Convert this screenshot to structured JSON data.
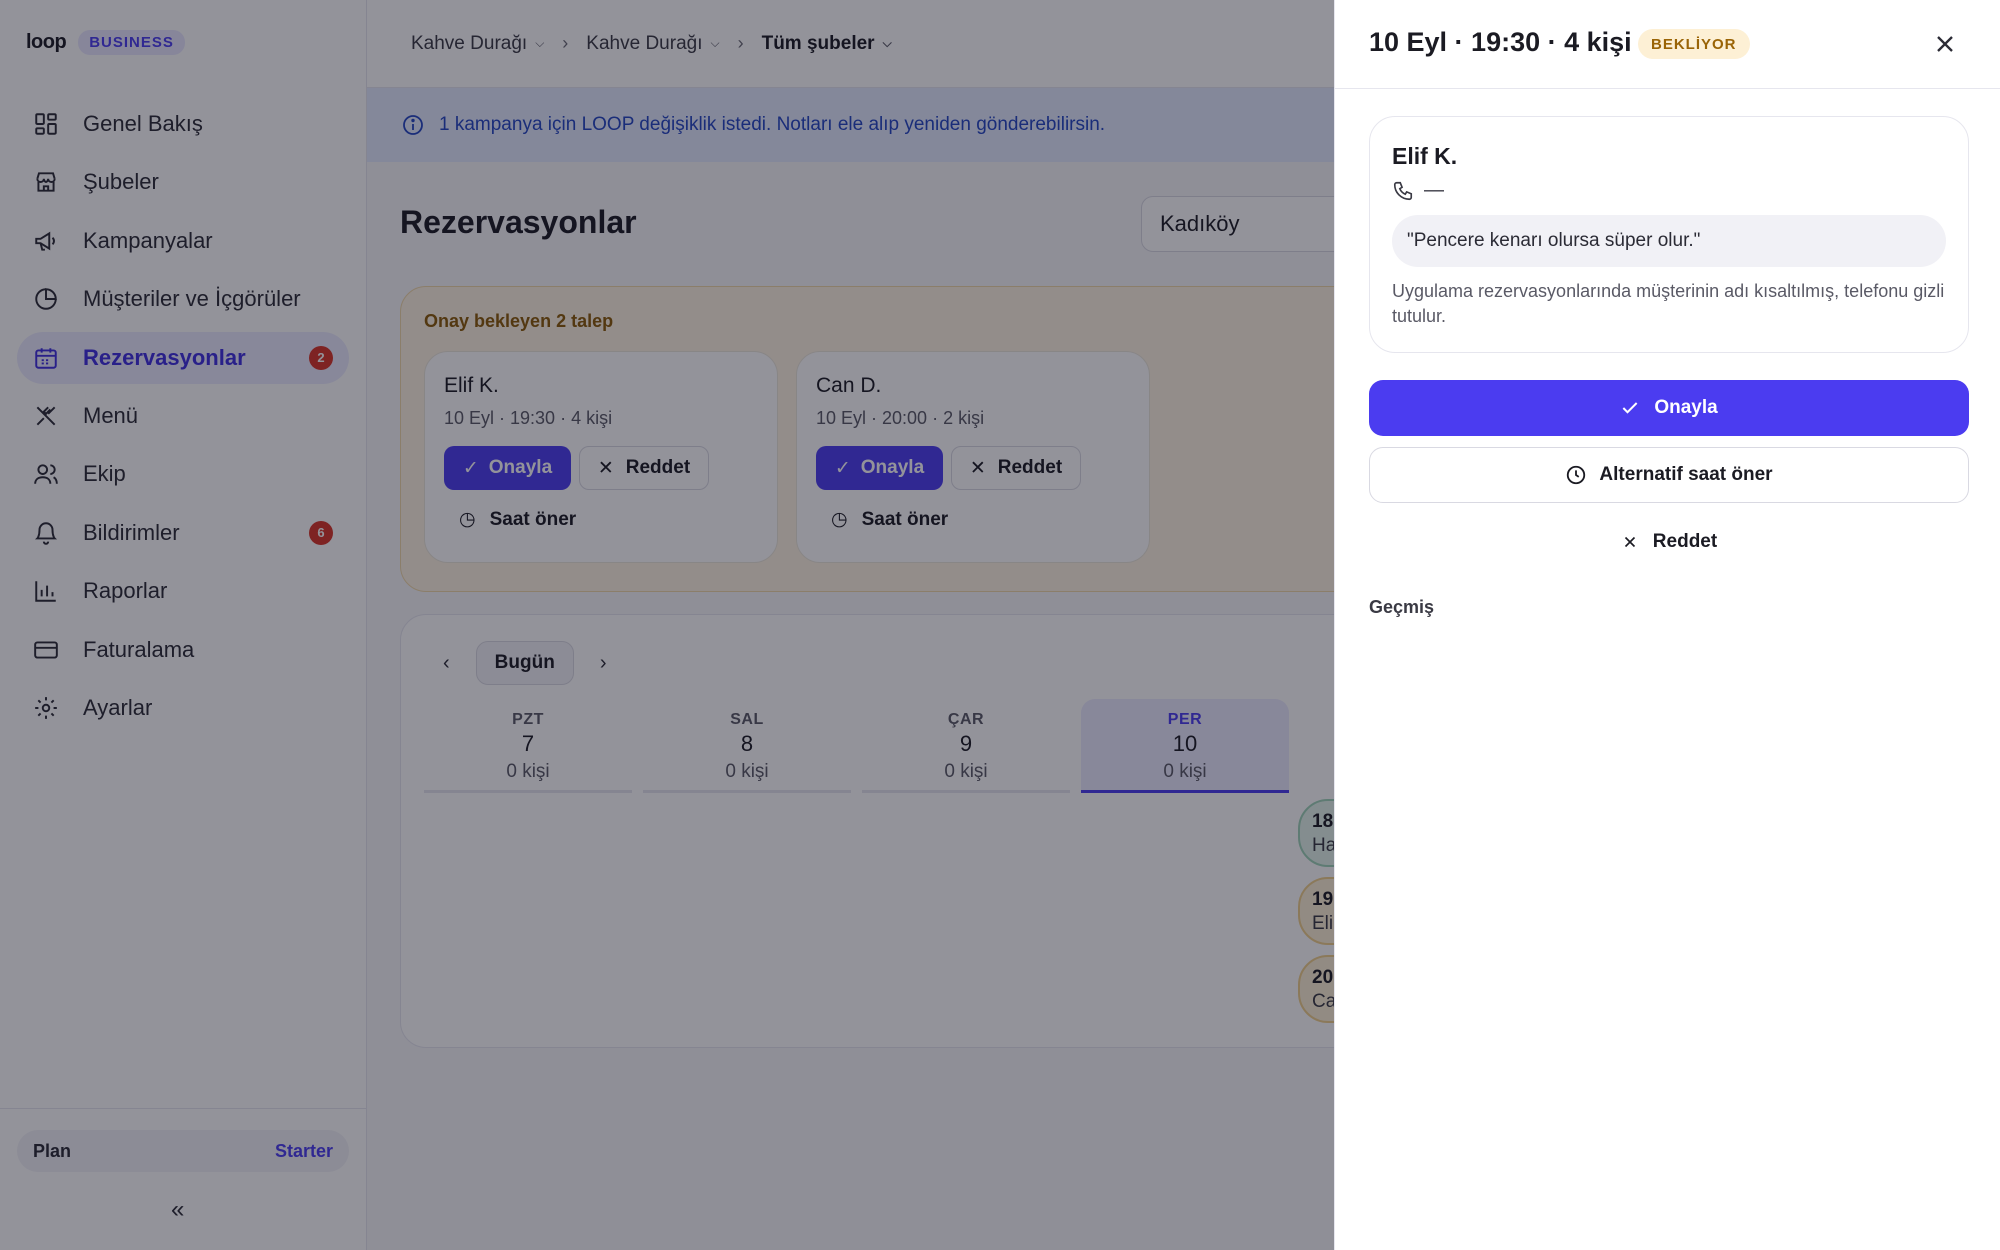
{
  "brand": {
    "logo": "loop",
    "badge": "BUSINESS"
  },
  "sidebar": {
    "items": [
      {
        "label": "Genel Bakış",
        "icon": "layout-grid-icon"
      },
      {
        "label": "Şubeler",
        "icon": "store-icon"
      },
      {
        "label": "Kampanyalar",
        "icon": "megaphone-icon"
      },
      {
        "label": "Müşteriler ve İçgörüler",
        "icon": "pie-chart-icon"
      },
      {
        "label": "Rezervasyonlar",
        "icon": "calendar-icon",
        "active": true,
        "count": "2"
      },
      {
        "label": "Menü",
        "icon": "utensils-icon"
      },
      {
        "label": "Ekip",
        "icon": "users-icon"
      },
      {
        "label": "Bildirimler",
        "icon": "bell-icon",
        "count": "6"
      },
      {
        "label": "Raporlar",
        "icon": "bar-chart-icon"
      },
      {
        "label": "Faturalama",
        "icon": "credit-card-icon"
      },
      {
        "label": "Ayarlar",
        "icon": "gear-icon"
      }
    ],
    "plan_label": "Plan",
    "plan_value": "Starter",
    "collapse_glyph": "«"
  },
  "breadcrumb": {
    "org": "Kahve Durağı",
    "brand": "Kahve Durağı",
    "branch": "Tüm şubeler"
  },
  "notice": {
    "text": "1 kampanya için LOOP değişiklik istedi. Notları ele alıp yeniden gönderebilirsin."
  },
  "main": {
    "title": "Rezervasyonlar",
    "branch_select": "Kadıköy",
    "pending": {
      "title": "Onay bekleyen 2 talep",
      "requests": [
        {
          "name": "Elif K.",
          "meta": "10 Eyl · 19:30 · 4 kişi",
          "approve": "Onayla",
          "reject": "Reddet",
          "suggest": "Saat öner"
        },
        {
          "name": "Can D.",
          "meta": "10 Eyl · 20:00 · 2 kişi",
          "approve": "Onayla",
          "reject": "Reddet",
          "suggest": "Saat öner"
        }
      ]
    },
    "calendar": {
      "today": "Bugün",
      "days": [
        {
          "name": "PZT",
          "num": "7",
          "count": "0 kişi"
        },
        {
          "name": "SAL",
          "num": "8",
          "count": "0 kişi"
        },
        {
          "name": "ÇAR",
          "num": "9",
          "count": "0 kişi"
        },
        {
          "name": "PER",
          "num": "10",
          "count": "0 kişi",
          "selected": true
        }
      ],
      "slots": [
        {
          "time": "18",
          "name": "Ha"
        },
        {
          "time": "19",
          "name": "Eli"
        },
        {
          "time": "20",
          "name": "Ca"
        }
      ]
    }
  },
  "drawer": {
    "title": "10 Eyl · 19:30 · 4 kişi",
    "status": "BEKLİYOR",
    "guest": {
      "name": "Elif K.",
      "phone": "—",
      "note": "\"Pencere kenarı olursa süper olur.\"",
      "info": "Uygulama rezervasyonlarında müşterinin adı kısaltılmış, telefonu gizli tutulur."
    },
    "approve": "Onayla",
    "alternative": "Alternatif saat öner",
    "reject": "Reddet",
    "history": "Geçmiş"
  },
  "colors": {
    "accent": "#4b3cf0",
    "badge_red": "#d93327",
    "pending_bg": "#fff4e2",
    "pending_text": "#8a5a07",
    "status_bg": "#fdf0d5",
    "status_text": "#9a6406",
    "notice_bg": "#e4ebff",
    "notice_text": "#2346c4",
    "slot_green": "#e4f4ec",
    "slot_amber": "#fdf0d5"
  }
}
